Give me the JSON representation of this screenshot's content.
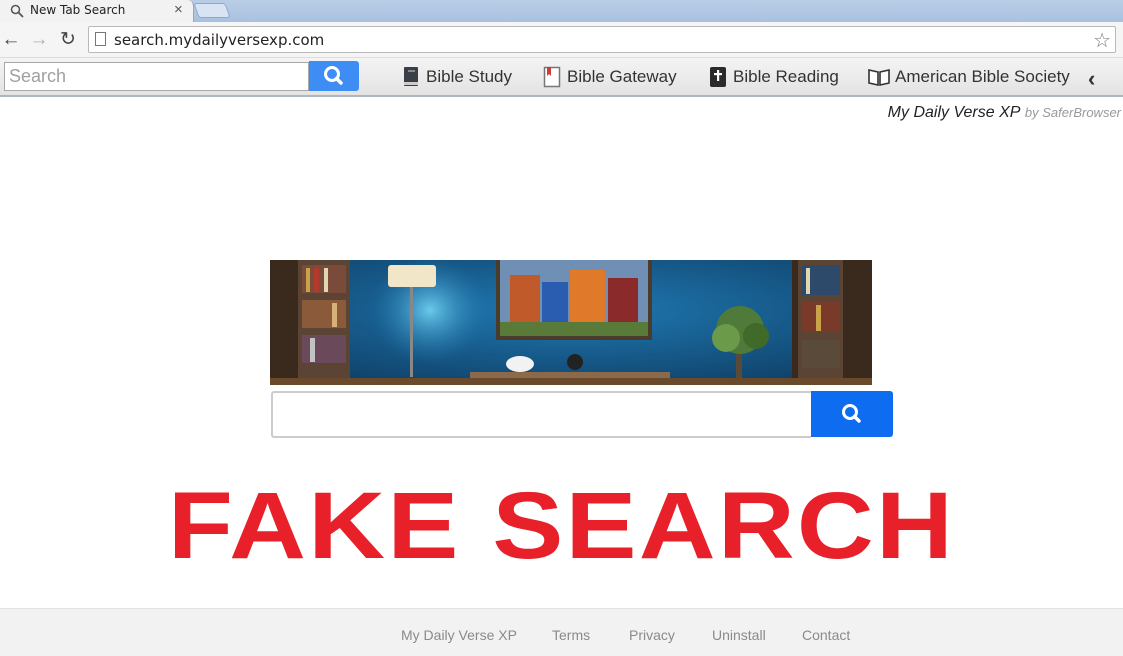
{
  "tab": {
    "title": "New Tab Search",
    "close": "×"
  },
  "nav": {
    "back": "←",
    "forward": "→",
    "reload": "↻",
    "url": "search.mydailyversexp.com",
    "star": "☆"
  },
  "toolbar": {
    "search_placeholder": "Search",
    "links": [
      {
        "label": "Bible Study",
        "icon": "book-icon"
      },
      {
        "label": "Bible Gateway",
        "icon": "bookmark-book-icon"
      },
      {
        "label": "Bible Reading",
        "icon": "cross-book-icon"
      },
      {
        "label": "American Bible Society",
        "icon": "open-book-icon"
      }
    ],
    "collapse": "‹"
  },
  "brand": {
    "name": "My Daily Verse XP",
    "by": "by SaferBrowser"
  },
  "headline": "FAKE SEARCH",
  "footer": {
    "links": [
      "My Daily Verse XP",
      "Terms",
      "Privacy",
      "Uninstall",
      "Contact"
    ]
  },
  "colors": {
    "search_button": "#3d8df5",
    "main_search_button": "#0e6cf0",
    "headline": "#e8202a"
  }
}
